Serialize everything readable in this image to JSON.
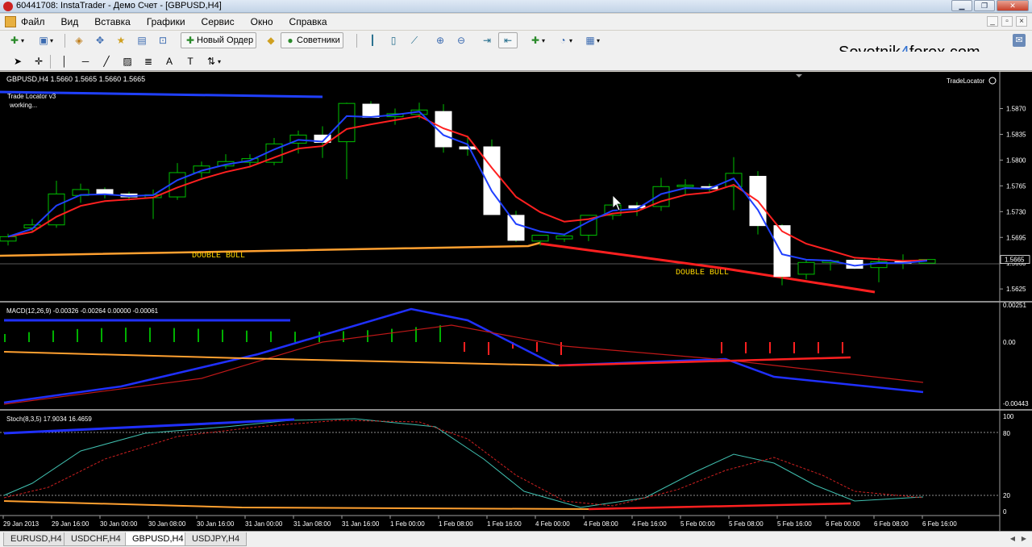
{
  "window": {
    "title": "60441708: InstaTrader - Демо Счет - [GBPUSD,H4]"
  },
  "menu": [
    "Файл",
    "Вид",
    "Вставка",
    "Графики",
    "Сервис",
    "Окно",
    "Справка"
  ],
  "toolbar": {
    "new_order": "Новый Ордер",
    "advisors": "Советники"
  },
  "brand": {
    "prefix": "Sovetnik",
    "digit": "4",
    "suffix": "forex.com"
  },
  "chart": {
    "symbol_header": "GBPUSD,H4  1.5660 1.5665 1.5660 1.5665",
    "indicator_name": "Trade Locator v3",
    "indicator_status": "working...",
    "trade_locator_label": "TradeLocator",
    "double_bull_labels": [
      "DOUBLE BULL",
      "DOUBLE BULL"
    ],
    "current_price": "1.5665",
    "price_axis": [
      "1.5870",
      "1.5835",
      "1.5800",
      "1.5765",
      "1.5730",
      "1.5695",
      "1.5660",
      "1.5625"
    ],
    "price_range": [
      1.5612,
      1.5898
    ],
    "time_axis": [
      "29 Jan 2013",
      "29 Jan 16:00",
      "30 Jan 00:00",
      "30 Jan 08:00",
      "30 Jan 16:00",
      "31 Jan 00:00",
      "31 Jan 08:00",
      "31 Jan 16:00",
      "1 Feb 00:00",
      "1 Feb 08:00",
      "1 Feb 16:00",
      "4 Feb 00:00",
      "4 Feb 08:00",
      "4 Feb 16:00",
      "5 Feb 00:00",
      "5 Feb 08:00",
      "5 Feb 16:00",
      "6 Feb 00:00",
      "6 Feb 08:00",
      "6 Feb 16:00"
    ],
    "candles": [
      [
        1.569,
        1.57,
        1.5684,
        1.5696
      ],
      [
        1.5708,
        1.572,
        1.5703,
        1.5712
      ],
      [
        1.5712,
        1.5772,
        1.5708,
        1.5754
      ],
      [
        1.5752,
        1.5768,
        1.5742,
        1.576
      ],
      [
        1.576,
        1.5763,
        1.5748,
        1.5754
      ],
      [
        1.5754,
        1.5757,
        1.5745,
        1.575
      ],
      [
        1.5749,
        1.576,
        1.572,
        1.5753
      ],
      [
        1.575,
        1.5796,
        1.5746,
        1.5783
      ],
      [
        1.5783,
        1.5798,
        1.5776,
        1.5792
      ],
      [
        1.5792,
        1.5808,
        1.5788,
        1.5798
      ],
      [
        1.5797,
        1.5808,
        1.579,
        1.5802
      ],
      [
        1.5797,
        1.583,
        1.5793,
        1.5822
      ],
      [
        1.5823,
        1.584,
        1.5809,
        1.5834
      ],
      [
        1.5834,
        1.5846,
        1.5803,
        1.5824
      ],
      [
        1.5825,
        1.5878,
        1.5774,
        1.5877
      ],
      [
        1.5876,
        1.588,
        1.586,
        1.5858
      ],
      [
        1.5859,
        1.587,
        1.5848,
        1.5863
      ],
      [
        1.5862,
        1.5878,
        1.5856,
        1.5868
      ],
      [
        1.5866,
        1.5876,
        1.581,
        1.5818
      ],
      [
        1.5818,
        1.5833,
        1.5806,
        1.5815
      ],
      [
        1.5818,
        1.5828,
        1.5732,
        1.5726
      ],
      [
        1.5725,
        1.5731,
        1.5689,
        1.5691
      ],
      [
        1.569,
        1.5697,
        1.5684,
        1.5698
      ],
      [
        1.5693,
        1.5698,
        1.5689,
        1.5697
      ],
      [
        1.5698,
        1.57,
        1.569,
        1.5725
      ],
      [
        1.5725,
        1.5749,
        1.5719,
        1.5739
      ],
      [
        1.5738,
        1.5743,
        1.5724,
        1.5735
      ],
      [
        1.5737,
        1.5776,
        1.5731,
        1.5764
      ],
      [
        1.5764,
        1.5774,
        1.5752,
        1.5766
      ],
      [
        1.5764,
        1.5768,
        1.5756,
        1.5761
      ],
      [
        1.5764,
        1.5804,
        1.5732,
        1.5782
      ],
      [
        1.5778,
        1.5785,
        1.5699,
        1.5711
      ],
      [
        1.5711,
        1.5713,
        1.563,
        1.5642
      ],
      [
        1.5645,
        1.5665,
        1.5638,
        1.5661
      ],
      [
        1.5661,
        1.5665,
        1.565,
        1.5663
      ],
      [
        1.5664,
        1.5666,
        1.5652,
        1.5653
      ],
      [
        1.5654,
        1.5668,
        1.5634,
        1.5662
      ],
      [
        1.5662,
        1.5672,
        1.5652,
        1.566
      ],
      [
        1.566,
        1.5665,
        1.566,
        1.5665
      ]
    ],
    "macd": {
      "label": "MACD(12,26,9) -0.00326 -0.00264 0.00000 -0.00061",
      "axis": [
        "0.00251",
        "0.00",
        "-0.00443"
      ]
    },
    "stoch": {
      "label": "Stoch(8,3,5) 17.9034 16.4659",
      "axis": [
        "100",
        "80",
        "20",
        "0"
      ]
    }
  },
  "tabs": [
    "EURUSD,H4",
    "USDCHF,H4",
    "GBPUSD,H4",
    "USDJPY,H4"
  ],
  "active_tab": "GBPUSD,H4",
  "colors": {
    "background": "#000000",
    "bull_candle": "#ffffff",
    "wick": "#00c000",
    "ma_fast": "#2040ff",
    "ma_slow": "#ff2020",
    "level_line": "#ffa030",
    "label_text": "#ffd700"
  }
}
